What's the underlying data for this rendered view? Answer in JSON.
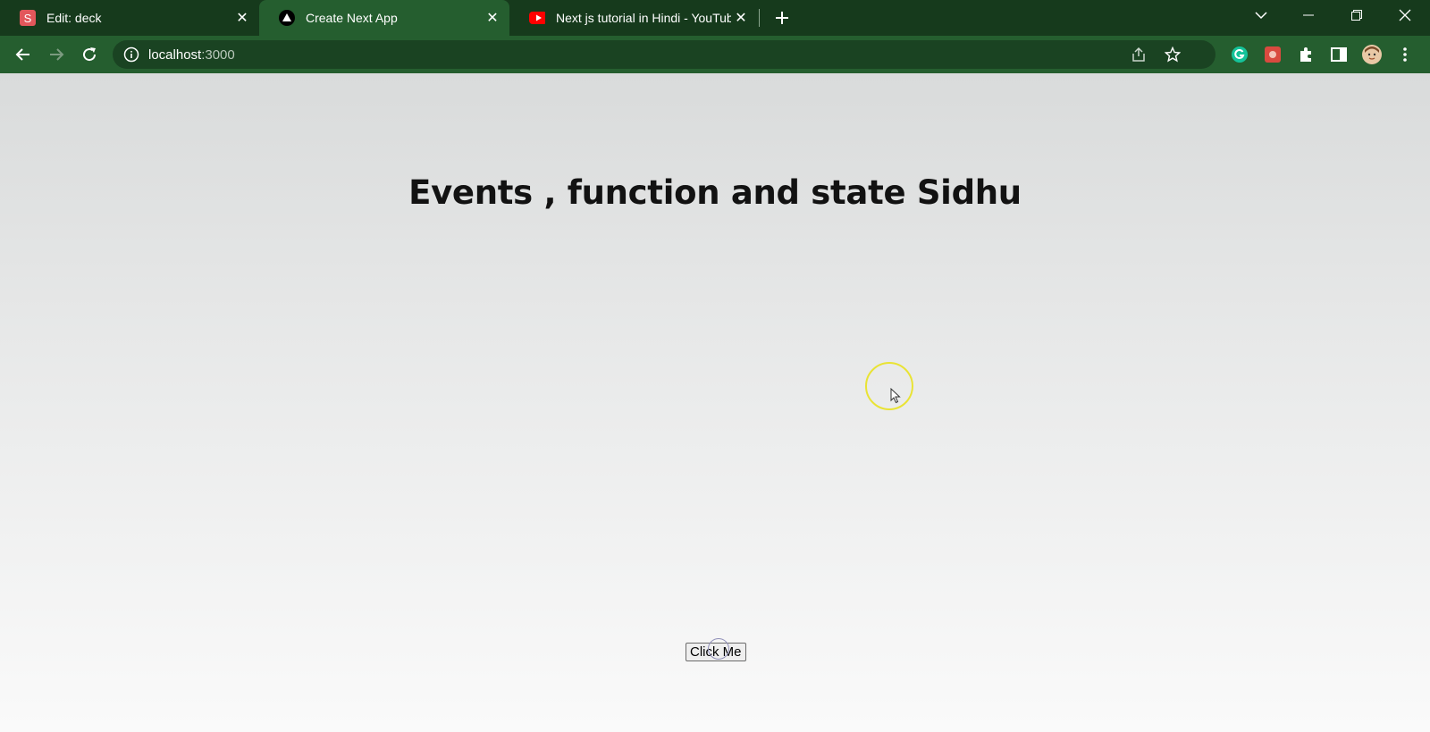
{
  "browser": {
    "tabs": [
      {
        "label": "Edit: deck",
        "favicon": "slides-s-icon",
        "active": false
      },
      {
        "label": "Create Next App",
        "favicon": "nextjs-triangle-icon",
        "active": true
      },
      {
        "label": "Next js tutorial in Hindi - YouTube",
        "favicon": "youtube-icon",
        "active": false
      }
    ],
    "address": {
      "host": "localhost",
      "port": ":3000"
    }
  },
  "page": {
    "heading": "Events , function and state Sidhu",
    "button_label": "Click Me"
  },
  "colors": {
    "tabstrip": "#163a1c",
    "toolbar": "#255e2f",
    "cursor_highlight": "#e9e334"
  }
}
